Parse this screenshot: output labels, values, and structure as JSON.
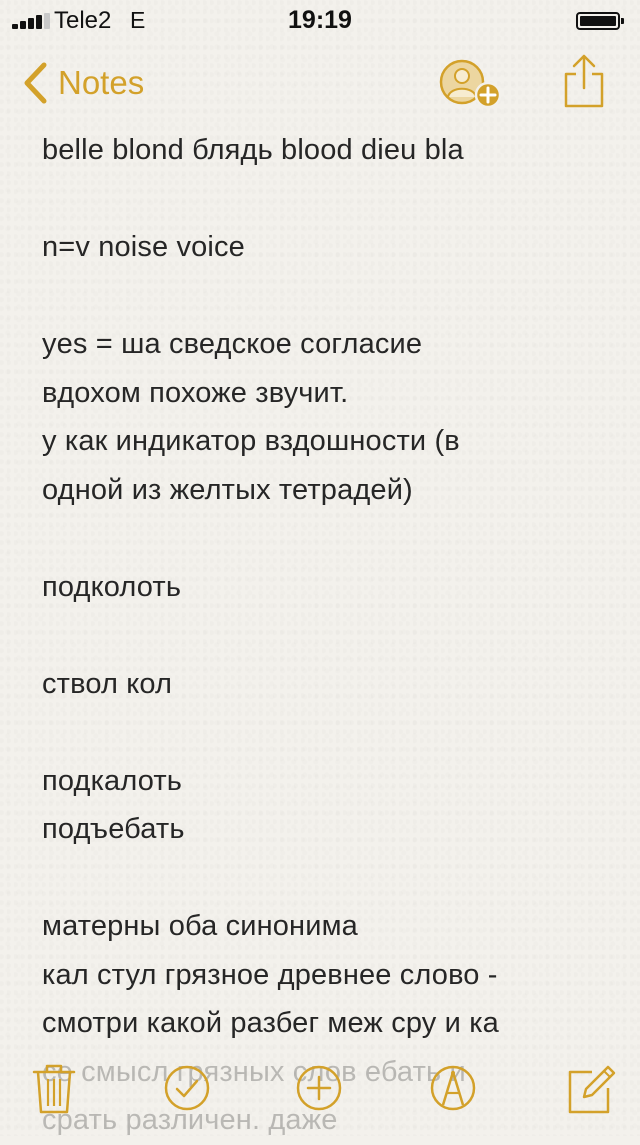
{
  "status_bar": {
    "carrier": "Tele2",
    "network": "E",
    "time": "19:19"
  },
  "nav": {
    "back_label": "Notes"
  },
  "note": {
    "lines": [
      "belle blond блядь blood dieu bla",
      "",
      "n=v noise voice",
      "",
      "yes = ша сведское согласие",
      "вдохом похоже звучит.",
      "у как индикатор вздошности (в",
      "одной из желтых тетрадей)",
      "",
      "подколоть",
      "",
      "ствол кол",
      "",
      "подкалоть",
      "подъебать",
      "",
      "матерны оба синонима",
      "кал стул грязное древнее слово -",
      "смотри какой разбег меж сру и ка",
      "се смысл грязных слов ебать и",
      "срать различен. даже"
    ]
  },
  "colors": {
    "accent": "#d3a12a",
    "text": "#262626",
    "background": "#f3f1ec"
  },
  "icons": {
    "back": "chevron-left-icon",
    "add_people": "add-person-icon",
    "share": "share-icon",
    "trash": "trash-icon",
    "checklist": "checklist-icon",
    "add": "plus-circle-icon",
    "sketch": "sketch-pen-icon",
    "compose": "compose-icon"
  }
}
